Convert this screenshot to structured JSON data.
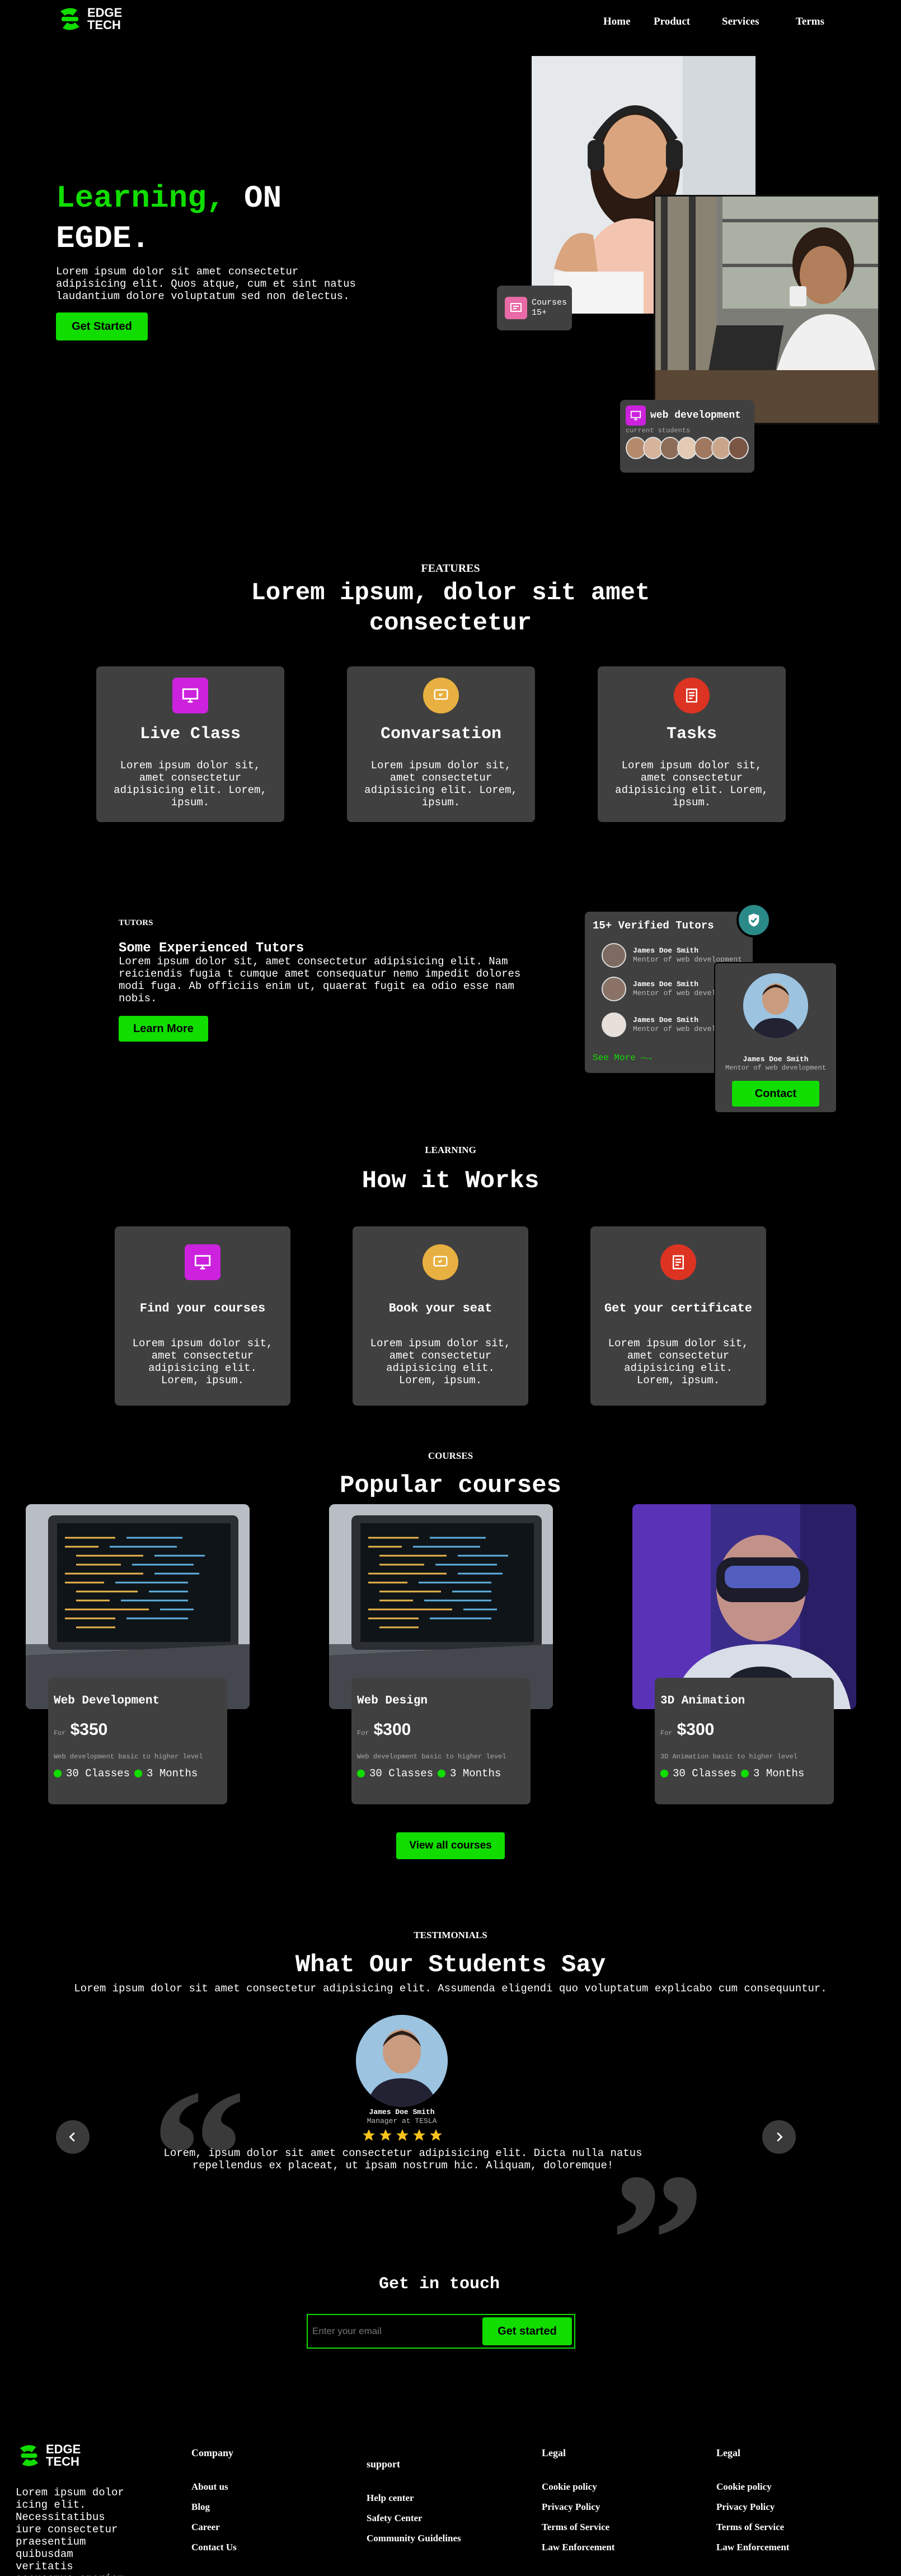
{
  "brand": {
    "line1": "EDGE",
    "line2": "TECH"
  },
  "nav": [
    "Home",
    "Product",
    "Services",
    "Terms"
  ],
  "hero": {
    "title_green": "Learning,",
    "title_rest": " ON",
    "title_line2": "EGDE.",
    "desc": "Lorem ipsum dolor sit amet consectetur adipisicing elit. Quos atque, cum et sint natus laudantium dolore voluptatum sed non delectus.",
    "cta": "Get Started",
    "courses_badge": {
      "label": "Courses",
      "count": "15+"
    },
    "webdev_badge": {
      "title": "web development",
      "sub": "current students"
    }
  },
  "features": {
    "eyebrow": "FEATURES",
    "title": "Lorem ipsum, dolor sit amet consectetur",
    "items": [
      {
        "title": "Live Class",
        "desc": "Lorem ipsum dolor sit, amet consectetur adipisicing elit. Lorem, ipsum.",
        "color": "#cc22dd",
        "icon": "monitor-icon"
      },
      {
        "title": "Convarsation",
        "desc": "Lorem ipsum dolor sit, amet consectetur adipisicing elit. Lorem, ipsum.",
        "color": "#e8b040",
        "icon": "chat-icon"
      },
      {
        "title": "Tasks",
        "desc": "Lorem ipsum dolor sit, amet consectetur adipisicing elit. Lorem, ipsum.",
        "color": "#dd3322",
        "icon": "document-icon"
      }
    ]
  },
  "tutors": {
    "eyebrow": "TUTORS",
    "title": "Some Experienced Tutors",
    "desc": "Lorem ipsum dolor sit, amet consectetur adipisicing elit. Nam reiciendis fugia t cumque amet consequatur nemo impedit dolores modi fuga. Ab officiis enim ut, quaerat fugit ea odio esse nam nobis.",
    "cta": "Learn More",
    "list_title": "15+ Verified Tutors",
    "list": [
      {
        "name": "James Doe Smith",
        "role": "Mentor of web development"
      },
      {
        "name": "James Doe Smith",
        "role": "Mentor of web development"
      },
      {
        "name": "James Doe Smith",
        "role": "Mentor of web development"
      }
    ],
    "see_more": "See More —→",
    "profile": {
      "name": "James Doe Smith",
      "role": "Mentor of web development",
      "cta": "Contact"
    }
  },
  "learning": {
    "eyebrow": "LEARNING",
    "title": "How it Works",
    "items": [
      {
        "title": "Find your courses",
        "desc": "Lorem ipsum dolor sit, amet consectetur adipisicing elit. Lorem, ipsum.",
        "color": "#cc22dd",
        "icon": "monitor-icon"
      },
      {
        "title": "Book your seat",
        "desc": "Lorem ipsum dolor sit, amet consectetur adipisicing elit. Lorem, ipsum.",
        "color": "#e8b040",
        "icon": "chat-icon"
      },
      {
        "title": "Get your certificate",
        "desc": "Lorem ipsum dolor sit, amet consectetur adipisicing elit. Lorem, ipsum.",
        "color": "#dd3322",
        "icon": "document-icon"
      }
    ]
  },
  "courses": {
    "eyebrow": "COURSES",
    "title": "Popular courses",
    "items": [
      {
        "title": "Web Development",
        "for": "For",
        "price": "$350",
        "desc": "Web development basic to higher level",
        "classes": "30 Classes",
        "months": "3 Months"
      },
      {
        "title": "Web Design",
        "for": "For",
        "price": "$300",
        "desc": "Web development basic to higher level",
        "classes": "30 Classes",
        "months": "3 Months"
      },
      {
        "title": "3D Animation",
        "for": "For",
        "price": "$300",
        "desc": "3D Animation basic to higher level",
        "classes": "30 Classes",
        "months": "3 Months"
      }
    ],
    "cta": "View all courses"
  },
  "testimonials": {
    "eyebrow": "TESTIMONIALS",
    "title": "What Our Students Say",
    "sub": "Lorem ipsum dolor sit amet consectetur adipisicing elit. Assumenda eligendi quo voluptatum explicabo cum consequuntur.",
    "name": "James Doe Smith",
    "role": "Manager at TESLA",
    "rating": 5,
    "quote": "Lorem, ipsum dolor sit amet consectetur adipisicing elit. Dicta nulla natus repellendus ex placeat, ut ipsam nostrum hic. Aliquam, doloremque!"
  },
  "contact": {
    "title": "Get in touch",
    "placeholder": "Enter your email",
    "cta": "Get started"
  },
  "footer": {
    "about": "Lorem ipsum dolor icing elit. Necessitatibus iure consectetur praesentium quibusdam veritatis accusamus aperiam",
    "cols": [
      {
        "title": "Company",
        "items": [
          "About us",
          "Blog",
          "Career",
          "Contact Us"
        ]
      },
      {
        "title": "support",
        "items": [
          "Help center",
          "Safety Center",
          "Community Guidelines"
        ]
      },
      {
        "title": "Legal",
        "items": [
          "Cookie policy",
          "Privacy Policy",
          "Terms of Service",
          "Law Enforcement"
        ]
      },
      {
        "title": "Legal",
        "items": [
          "Cookie policy",
          "Privacy Policy",
          "Terms of Service",
          "Law Enforcement"
        ]
      }
    ]
  },
  "colors": {
    "accent": "#11dd00",
    "card": "#404040",
    "magenta": "#cc22dd",
    "amber": "#e8b040",
    "red": "#dd3322"
  }
}
